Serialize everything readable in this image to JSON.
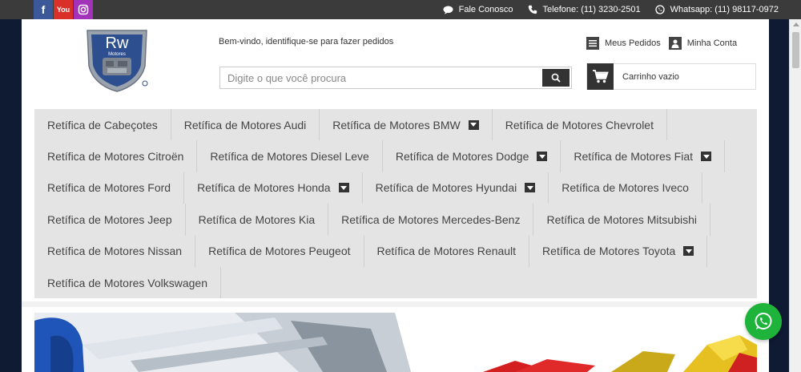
{
  "social": {
    "facebook": "f",
    "youtube": "You",
    "instagram": "ig"
  },
  "topbar": {
    "contact_label": "Fale Conosco",
    "phone_label": "Telefone: (11) 3230-2501",
    "whatsapp_label": "Whatsapp: (11) 98117-0972"
  },
  "header": {
    "logo_text": "Rw",
    "logo_sub": "Motores",
    "welcome": "Bem-vindo, identifique-se para fazer pedidos",
    "search_placeholder": "Digite o que você procura",
    "orders_label": "Meus Pedidos",
    "account_label": "Minha Conta",
    "cart_label": "Carrinho vazio"
  },
  "menu": {
    "items": [
      {
        "label": "Retífica de Cabeçotes",
        "dropdown": false
      },
      {
        "label": "Retífica de Motores Audi",
        "dropdown": false
      },
      {
        "label": "Retífica de Motores BMW",
        "dropdown": true
      },
      {
        "label": "Retífica de Motores Chevrolet",
        "dropdown": false
      },
      {
        "label": "Retífica de Motores Citroën",
        "dropdown": false
      },
      {
        "label": "Retífica de Motores Diesel Leve",
        "dropdown": false
      },
      {
        "label": "Retífica de Motores Dodge",
        "dropdown": true
      },
      {
        "label": "Retífica de Motores Fiat",
        "dropdown": true
      },
      {
        "label": "Retífica de Motores Ford",
        "dropdown": false
      },
      {
        "label": "Retífica de Motores Honda",
        "dropdown": true
      },
      {
        "label": "Retífica de Motores Hyundai",
        "dropdown": true
      },
      {
        "label": "Retífica de Motores Iveco",
        "dropdown": false
      },
      {
        "label": "Retífica de Motores Jeep",
        "dropdown": false
      },
      {
        "label": "Retífica de Motores Kia",
        "dropdown": false
      },
      {
        "label": "Retífica de Motores Mercedes-Benz",
        "dropdown": false
      },
      {
        "label": "Retífica de Motores Mitsubishi",
        "dropdown": false
      },
      {
        "label": "Retífica de Motores Nissan",
        "dropdown": false
      },
      {
        "label": "Retífica de Motores Peugeot",
        "dropdown": false
      },
      {
        "label": "Retífica de Motores Renault",
        "dropdown": false
      },
      {
        "label": "Retífica de Motores Toyota",
        "dropdown": true
      },
      {
        "label": "Retífica de Motores Volkswagen",
        "dropdown": false
      }
    ]
  },
  "colors": {
    "topbar": "#3b3b3b",
    "menu_bg": "#e4e4e4",
    "whatsapp": "#1eb33a",
    "facebook": "#3b5998",
    "youtube": "#d9302a",
    "instagram": "#a233b9"
  },
  "icons": {
    "contact": "speech-bubble-icon",
    "phone": "phone-icon",
    "whatsapp": "whatsapp-icon",
    "search": "search-icon",
    "orders": "list-icon",
    "account": "user-icon",
    "cart": "cart-icon"
  }
}
